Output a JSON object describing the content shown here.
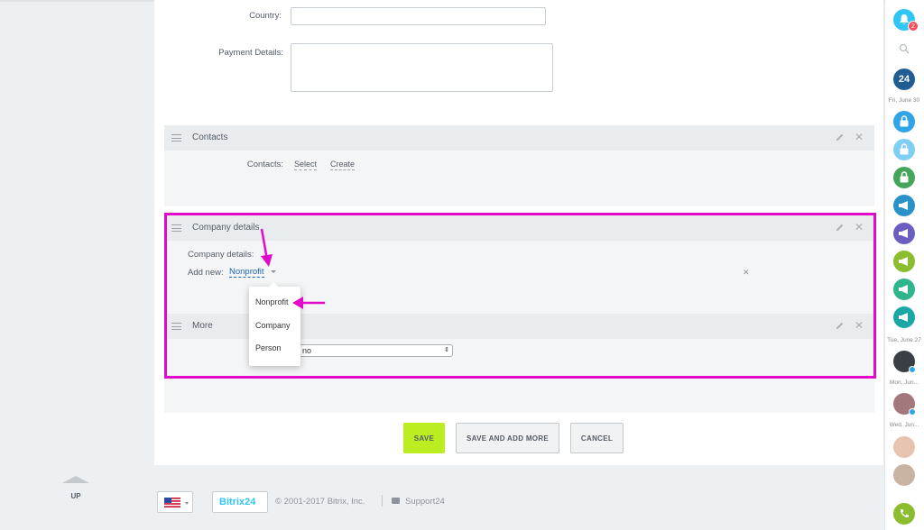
{
  "form": {
    "country_label": "Country:",
    "payment_label": "Payment Details:"
  },
  "contacts": {
    "title": "Contacts",
    "field_label": "Contacts:",
    "select": "Select",
    "create": "Create"
  },
  "company": {
    "title": "Company details",
    "field_label": "Company details:",
    "add_new": "Add new:",
    "selected": "Nonprofit"
  },
  "dropdown": {
    "options": [
      "Nonprofit",
      "Company",
      "Person"
    ]
  },
  "more": {
    "title": "More",
    "select_value": "no"
  },
  "buttons": {
    "save": "SAVE",
    "save_add": "SAVE AND ADD MORE",
    "cancel": "CANCEL"
  },
  "footer": {
    "up": "UP",
    "logo": "Bitrix24",
    "copyright": "© 2001-2017 Bitrix, Inc.",
    "support": "Support24"
  },
  "sidebar": {
    "notif_count": "2",
    "b24": "24",
    "dates": [
      "Fri, June 30",
      "Tue, June 27",
      "Mon, Jun...",
      "Wed, Jun..."
    ]
  },
  "colors": {
    "save_green": "#bbed21",
    "highlight": "#e10ac9",
    "link_blue": "#2067b0"
  }
}
